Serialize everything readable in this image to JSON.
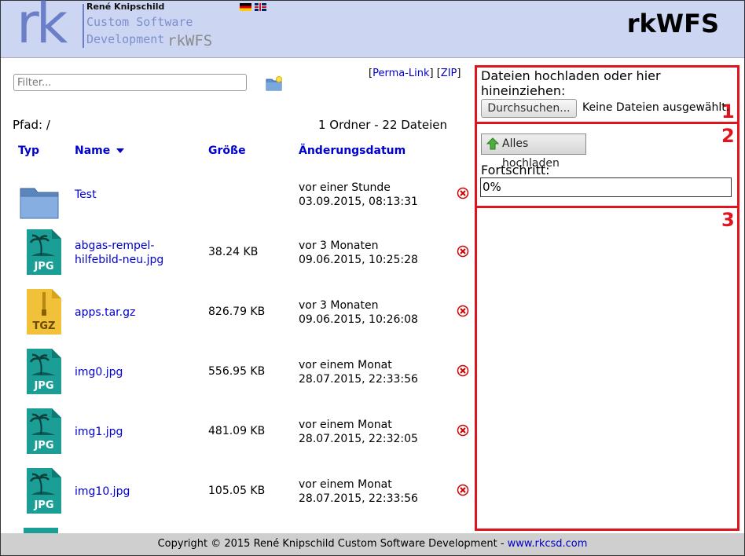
{
  "header": {
    "logo_text": "rk",
    "owner": "René Knipschild",
    "sub_line1": "Custom Software",
    "sub_line2": "Development",
    "app_small": "rkWFS",
    "app_title": "rkWFS",
    "languages": [
      "de-flag",
      "gb-flag"
    ]
  },
  "toolbar": {
    "filter_placeholder": "Filter...",
    "new_folder_icon": "new-folder-icon",
    "bracket_open": "[",
    "permalink": "Perma-Link",
    "bracket_mid": "] [",
    "zip": "ZIP",
    "bracket_close": "]"
  },
  "listing": {
    "path": "Pfad: /",
    "count": "1 Ordner - 22 Dateien",
    "columns": {
      "type": "Typ",
      "name": "Name",
      "size": "Größe",
      "date": "Änderungsdatum"
    },
    "rows": [
      {
        "icon": "folder-icon",
        "name_line1": "Test",
        "name_line2": "",
        "size": "",
        "date_rel": "vor einer Stunde",
        "date_abs": "03.09.2015, 08:13:31"
      },
      {
        "icon": "jpg-file-icon",
        "name_line1": "abgas-rempel-",
        "name_line2": "hilfebild-neu.jpg",
        "size": "38.24 KB",
        "date_rel": "vor 3 Monaten",
        "date_abs": "09.06.2015, 10:25:28"
      },
      {
        "icon": "tgz-file-icon",
        "name_line1": "apps.tar.gz",
        "name_line2": "",
        "size": "826.79 KB",
        "date_rel": "vor 3 Monaten",
        "date_abs": "09.06.2015, 10:26:08"
      },
      {
        "icon": "jpg-file-icon",
        "name_line1": "img0.jpg",
        "name_line2": "",
        "size": "556.95 KB",
        "date_rel": "vor einem Monat",
        "date_abs": "28.07.2015, 22:33:56"
      },
      {
        "icon": "jpg-file-icon",
        "name_line1": "img1.jpg",
        "name_line2": "",
        "size": "481.09 KB",
        "date_rel": "vor einem Monat",
        "date_abs": "28.07.2015, 22:32:05"
      },
      {
        "icon": "jpg-file-icon",
        "name_line1": "img10.jpg",
        "name_line2": "",
        "size": "105.05 KB",
        "date_rel": "vor einem Monat",
        "date_abs": "28.07.2015, 22:33:56"
      }
    ]
  },
  "upload": {
    "drop_text": "Dateien hochladen oder hier hineinziehen:",
    "browse_label": "Durchsuchen...",
    "no_files": "Keine Dateien ausgewählt.",
    "upload_all": "Alles hochladen",
    "progress_label": "Fortschritt:",
    "progress_text": "0%",
    "progress_value": 0,
    "box_numbers": [
      "1",
      "2",
      "3"
    ],
    "accent_color": "#e0141c"
  },
  "footer": {
    "text": "Copyright © 2015 René Knipschild Custom Software Development - ",
    "link": "www.rkcsd.com"
  }
}
